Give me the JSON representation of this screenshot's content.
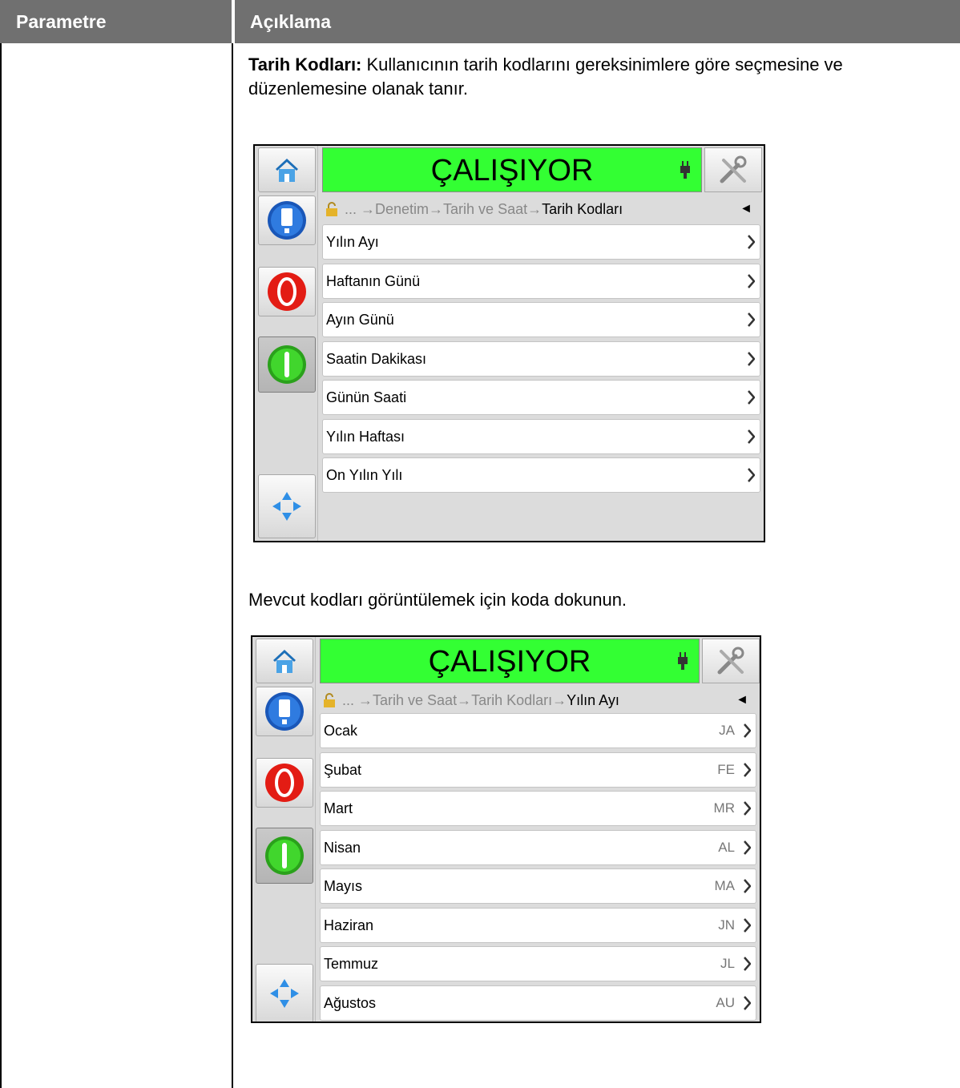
{
  "table": {
    "header_param": "Parametre",
    "header_desc": "Açıklama"
  },
  "intro": {
    "term": "Tarih Kodları:",
    "text": " Kullanıcının tarih kodlarını gereksinimlere göre seçmesine ve düzenlemesine olanak tanır."
  },
  "instruction": "Mevcut kodları görüntülemek için koda dokunun.",
  "screen1": {
    "status": "ÇALIŞIYOR",
    "crumb_prefix": "... ",
    "crumb_path": "→Denetim→Tarih ve Saat→",
    "crumb_current": "Tarih Kodları",
    "back": "◄",
    "items": [
      "Yılın Ayı",
      "Haftanın Günü",
      "Ayın Günü",
      "Saatin Dakikası",
      "Günün Saati",
      "Yılın Haftası",
      "On Yılın Yılı"
    ]
  },
  "screen2": {
    "status": "ÇALIŞIYOR",
    "crumb_prefix": "... ",
    "crumb_path": "→Tarih ve Saat→Tarih Kodları→",
    "crumb_current": "Yılın Ayı",
    "back": "◄",
    "items": [
      {
        "label": "Ocak",
        "code": "JA"
      },
      {
        "label": "Şubat",
        "code": "FE"
      },
      {
        "label": "Mart",
        "code": "MR"
      },
      {
        "label": "Nisan",
        "code": "AL"
      },
      {
        "label": "Mayıs",
        "code": "MA"
      },
      {
        "label": "Haziran",
        "code": "JN"
      },
      {
        "label": "Temmuz",
        "code": "JL"
      },
      {
        "label": "Ağustos",
        "code": "AU"
      }
    ]
  },
  "icons": {
    "home": "home-icon",
    "tools": "tools-icon",
    "plug": "plug-icon",
    "lock": "lock-icon",
    "info": "info-icon",
    "stop": "stop-icon",
    "start": "start-icon",
    "navigate": "navigate-icon",
    "chevron": "chevron-right-icon"
  },
  "colors": {
    "status_running": "#33ff33",
    "header_bg": "#707070"
  }
}
